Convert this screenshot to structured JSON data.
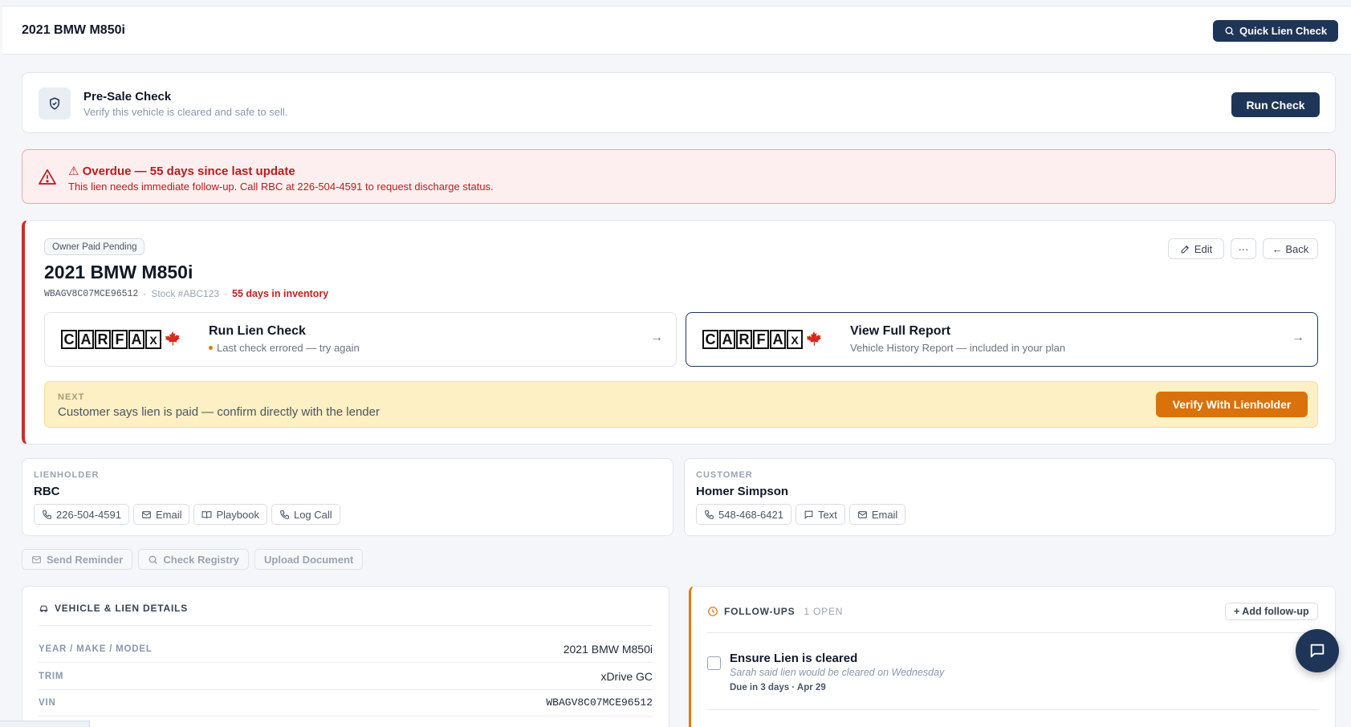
{
  "header": {
    "title": "2021 BMW M850i",
    "quick_check_label": "Quick Lien Check"
  },
  "presale": {
    "title": "Pre-Sale Check",
    "subtitle": "Verify this vehicle is cleared and safe to sell.",
    "button": "Run Check"
  },
  "alert": {
    "title": "⚠ Overdue — 55 days since last update",
    "message": "This lien needs immediate follow-up. Call RBC at 226-504-4591 to request discharge status.",
    "color": "#b91c1c"
  },
  "vehicle": {
    "status": "Owner Paid Pending",
    "title": "2021 BMW M850i",
    "vin": "WBAGV8C07MCE96512",
    "stock": "Stock #ABC123",
    "separator": "·",
    "days": "55 days in inventory",
    "edit_label": "Edit",
    "more_label": "···",
    "back_label": "← Back",
    "accent_color": "#d12b2b"
  },
  "carfax": {
    "logo_letters": [
      "C",
      "A",
      "R",
      "F",
      "A",
      "X"
    ],
    "lien_check": {
      "title": "Run Lien Check",
      "status": "Last check errored — try again",
      "arrow": "→"
    },
    "full_report": {
      "title": "View Full Report",
      "subtitle": "Vehicle History Report — included in your plan",
      "arrow": "→"
    }
  },
  "next_step": {
    "label": "NEXT",
    "text": "Customer says lien is paid — confirm directly with the lender",
    "button": "Verify With Lienholder"
  },
  "lienholder": {
    "section": "LIENHOLDER",
    "name": "RBC",
    "actions": [
      {
        "label": "226-504-4591",
        "icon": "phone-icon"
      },
      {
        "label": "Email",
        "icon": "mail-icon"
      },
      {
        "label": "Playbook",
        "icon": "book-icon"
      },
      {
        "label": "Log Call",
        "icon": "phone-icon"
      }
    ]
  },
  "customer": {
    "section": "CUSTOMER",
    "name": "Homer Simpson",
    "actions": [
      {
        "label": "548-468-6421",
        "icon": "phone-icon"
      },
      {
        "label": "Text",
        "icon": "message-icon"
      },
      {
        "label": "Email",
        "icon": "mail-icon"
      }
    ]
  },
  "quick_actions": {
    "send_reminder": "Send Reminder",
    "check_registry": "Check Registry",
    "upload_document": "Upload Document"
  },
  "details": {
    "title": "VEHICLE & LIEN DETAILS",
    "rows": [
      {
        "key": "YEAR / MAKE / MODEL",
        "value": "2021 BMW M850i"
      },
      {
        "key": "TRIM",
        "value": "xDrive GC"
      },
      {
        "key": "VIN",
        "value": "WBAGV8C07MCE96512"
      }
    ]
  },
  "followups": {
    "title": "FOLLOW-UPS",
    "count": "1 OPEN",
    "add_label": "+ Add follow-up",
    "items": [
      {
        "title": "Ensure Lien is cleared",
        "note": "Sarah said lien would be cleared on Wednesday",
        "due": "Due in 3 days · Apr 29"
      }
    ]
  }
}
